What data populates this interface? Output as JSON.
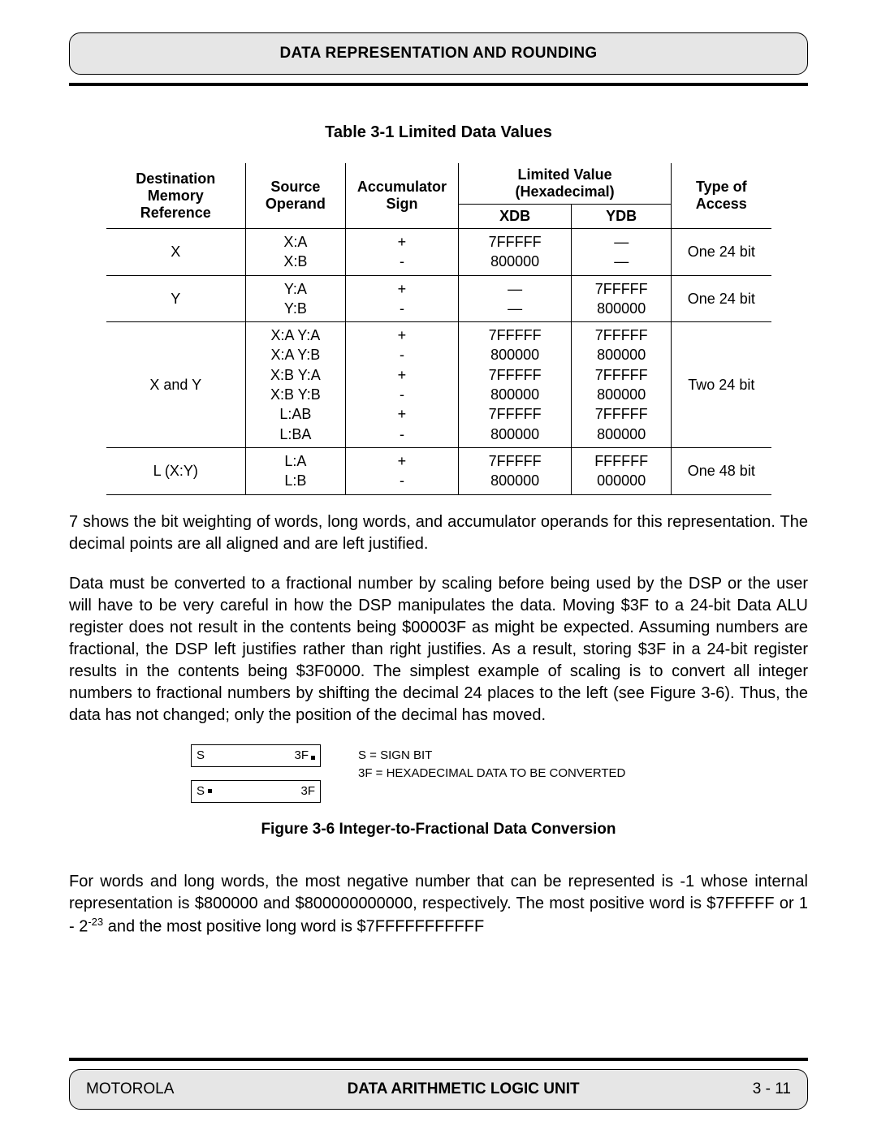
{
  "header": {
    "title": "DATA REPRESENTATION AND ROUNDING"
  },
  "table": {
    "caption": "Table 3-1 Limited Data Values",
    "headers": {
      "dest1": "Destination",
      "dest2": "Memory Reference",
      "src1": "Source",
      "src2": "Operand",
      "acc1": "Accumulator",
      "acc2": "Sign",
      "lv": "Limited Value (Hexadecimal)",
      "xdb": "XDB",
      "ydb": "YDB",
      "type1": "Type of",
      "type2": "Access"
    },
    "rows": [
      {
        "dest": "X",
        "src": "X:A\nX:B",
        "acc": "+\n-",
        "xdb": "7FFFFF\n800000",
        "ydb": "—\n—",
        "type": "One 24 bit"
      },
      {
        "dest": "Y",
        "src": "Y:A\nY:B",
        "acc": "+\n-",
        "xdb": "—\n—",
        "ydb": "7FFFFF\n800000",
        "type": "One 24 bit"
      },
      {
        "dest": "X and Y",
        "src": "X:A Y:A\nX:A Y:B\nX:B Y:A\nX:B Y:B\nL:AB\nL:BA",
        "acc": "+\n-\n+\n-\n+\n-",
        "xdb": "7FFFFF\n800000\n7FFFFF\n800000\n7FFFFF\n800000",
        "ydb": "7FFFFF\n800000\n7FFFFF\n800000\n7FFFFF\n800000",
        "type": "Two 24 bit"
      },
      {
        "dest": "L (X:Y)",
        "src": "L:A\nL:B",
        "acc": "+\n-",
        "xdb": "7FFFFF\n800000",
        "ydb": "FFFFFF\n000000",
        "type": "One 48 bit"
      }
    ]
  },
  "para1": "7 shows the bit weighting of words, long words, and accumulator operands for this representation. The decimal points are all aligned and are left justified.",
  "para2": "Data must be converted to a fractional number by scaling before being used by the DSP or the user will have to be very careful in how the DSP manipulates the data. Moving $3F to a 24-bit Data ALU register does not result in the contents being $00003F as might be expected. Assuming numbers are fractional, the DSP left justifies rather than right justifies. As a result, storing $3F in a 24-bit register results in the contents being $3F0000. The simplest example of scaling is to convert all integer numbers to fractional numbers by shifting the decimal 24 places to the left (see Figure 3-6). Thus, the data has not changed; only the position of the decimal has moved.",
  "figure": {
    "box1_left": "S",
    "box1_right": "3F",
    "box2_left": "S",
    "box2_right": "3F",
    "legend1": "S = SIGN BIT",
    "legend2": "3F = HEXADECIMAL DATA TO BE CONVERTED",
    "caption": "Figure 3-6 Integer-to-Fractional Data Conversion"
  },
  "para3_pre": "For words and long words, the most negative number that can be represented is -1 whose internal representation is $800000 and $800000000000, respectively. The most positive word is $7FFFFF or 1 - 2",
  "para3_sup": "-23",
  "para3_post": " and the most positive long word is $7FFFFFFFFFFF",
  "footer": {
    "left": "MOTOROLA",
    "center": "DATA ARITHMETIC LOGIC UNIT",
    "right": "3 - 11"
  }
}
